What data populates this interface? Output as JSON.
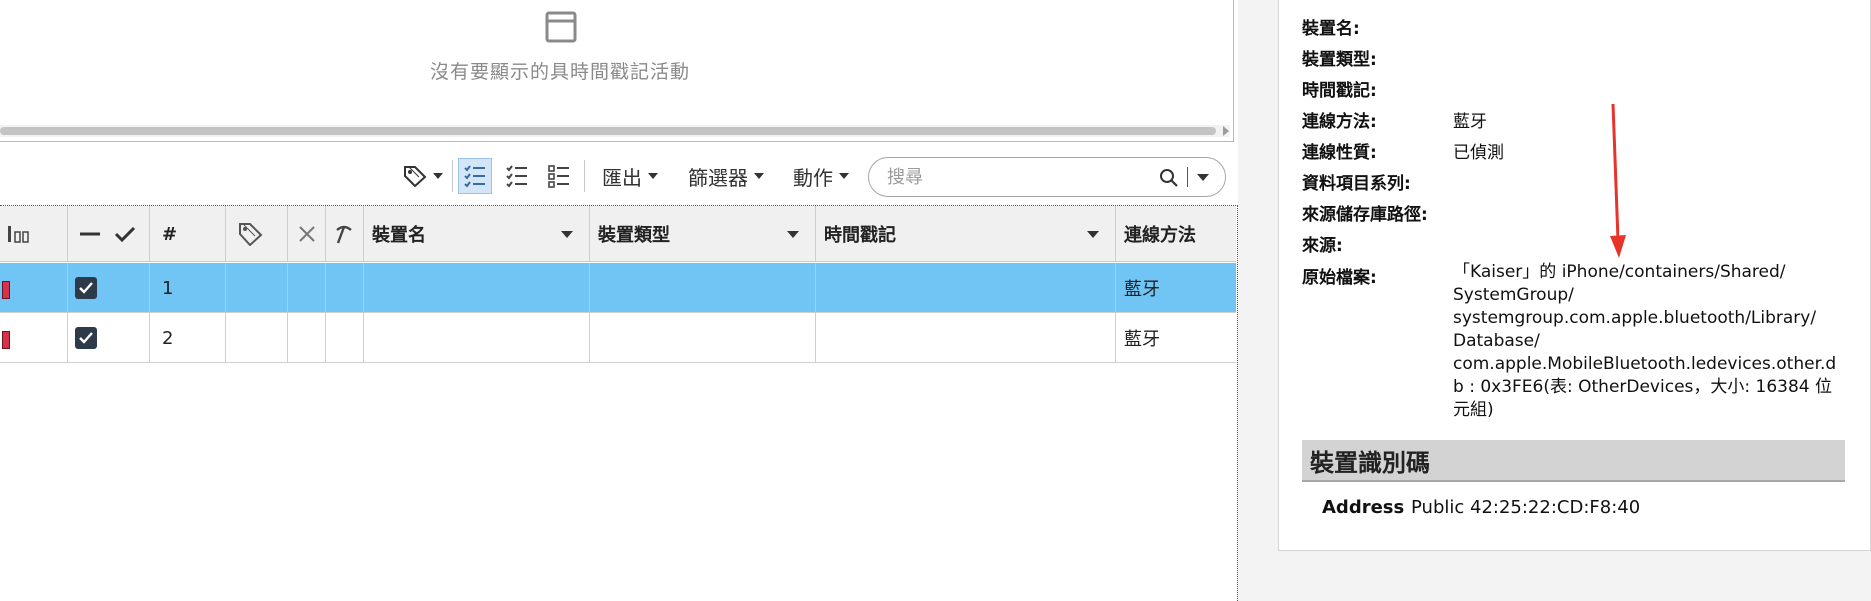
{
  "timeline": {
    "empty_message": "沒有要顯示的具時間戳記活動"
  },
  "toolbar": {
    "export_label": "匯出",
    "filter_label": "篩選器",
    "action_label": "動作",
    "search_placeholder": "搜尋"
  },
  "table": {
    "columns": {
      "number": "#",
      "device_name": "裝置名",
      "device_type": "裝置類型",
      "timestamp": "時間戳記",
      "connection_method": "連線方法"
    },
    "rows": [
      {
        "number": "1",
        "device_name": "",
        "device_type": "",
        "timestamp": "",
        "connection_method": "藍牙",
        "checked": true,
        "selected": true
      },
      {
        "number": "2",
        "device_name": "",
        "device_type": "",
        "timestamp": "",
        "connection_method": "藍牙",
        "checked": true,
        "selected": false
      }
    ]
  },
  "detail": {
    "fields": [
      {
        "key": "裝置名:",
        "value": ""
      },
      {
        "key": "裝置類型:",
        "value": ""
      },
      {
        "key": "時間戳記:",
        "value": ""
      },
      {
        "key": "連線方法:",
        "value": "藍牙"
      },
      {
        "key": "連線性質:",
        "value": "已偵測"
      },
      {
        "key": "資料項目系列:",
        "value": ""
      },
      {
        "key": "來源儲存庫路徑:",
        "value": ""
      },
      {
        "key": "來源:",
        "value": ""
      },
      {
        "key": "原始檔案:",
        "value": ""
      }
    ],
    "original_file_lines": [
      "「Kaiser」的 iPhone/containers/Shared/",
      "SystemGroup/",
      "systemgroup.com.apple.bluetooth/Library/",
      "Database/",
      "com.apple.MobileBluetooth.ledevices.other.d",
      "b : 0x3FE6(表: OtherDevices，大小: 16384 位",
      "元組)"
    ],
    "identifier_section_title": "裝置識別碼",
    "address_key": "Address",
    "address_value": "Public 42:25:22:CD:F8:40"
  },
  "colors": {
    "selected_row": "#71c5f4",
    "flag_red": "#d6334a",
    "annotation_arrow": "#e8322c"
  }
}
